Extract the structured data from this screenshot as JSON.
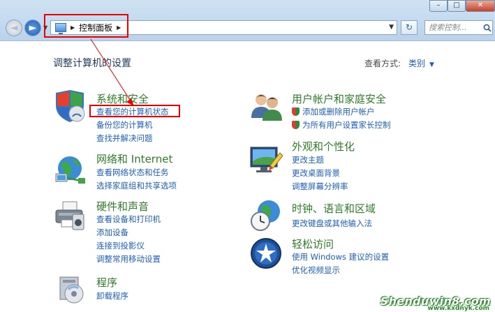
{
  "window": {
    "minimize": "–",
    "maximize": "□",
    "close": "✕"
  },
  "nav": {
    "back": "◄",
    "forward": "►",
    "dropdown": "▼"
  },
  "address": {
    "path": "控制面板",
    "separator": "▶",
    "refresh": "↻"
  },
  "search": {
    "placeholder": "搜索控制..."
  },
  "page": {
    "title": "调整计算机的设置",
    "view_label": "查看方式:",
    "view_value": "类别",
    "view_caret": "▼"
  },
  "categories": {
    "security": {
      "title": "系统和安全",
      "icon": "shield-icon",
      "links": [
        "查看您的计算机状态",
        "备份您的计算机",
        "查找并解决问题"
      ]
    },
    "network": {
      "title": "网络和 Internet",
      "icon": "network-icon",
      "links": [
        "查看网络状态和任务",
        "选择家庭组和共享选项"
      ]
    },
    "hardware": {
      "title": "硬件和声音",
      "icon": "printer-icon",
      "links": [
        "查看设备和打印机",
        "添加设备",
        "连接到投影仪",
        "调整常用移动设置"
      ]
    },
    "programs": {
      "title": "程序",
      "icon": "programs-icon",
      "links": [
        "卸载程序"
      ]
    },
    "users": {
      "title": "用户帐户和家庭安全",
      "icon": "users-icon",
      "links": [
        "添加或删除用户帐户",
        "为所有用户设置家长控制"
      ]
    },
    "appearance": {
      "title": "外观和个性化",
      "icon": "display-icon",
      "links": [
        "更改主题",
        "更改桌面背景",
        "调整屏幕分辨率"
      ]
    },
    "clock": {
      "title": "时钟、语言和区域",
      "icon": "clock-globe-icon",
      "links": [
        "更改键盘或其他输入法"
      ]
    },
    "access": {
      "title": "轻松访问",
      "icon": "ease-of-access-icon",
      "links": [
        "使用 Windows 建议的设置",
        "优化视频显示"
      ]
    }
  },
  "watermark": {
    "text": "Shenduwin8.com",
    "sub": "www.kxdnyk.com"
  },
  "colors": {
    "title_green": "#2e7d27",
    "link_blue": "#1e5ebd",
    "highlight_red": "#e00000"
  }
}
